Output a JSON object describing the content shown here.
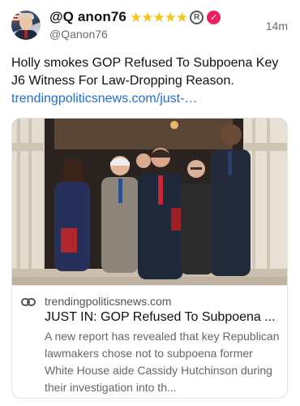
{
  "post": {
    "author": {
      "display_name": "@Q anon76",
      "stars": "★★★★★",
      "registered_mark": "R",
      "verified_mark": "✓",
      "handle": "@Qanon76"
    },
    "timestamp": "14m",
    "text": "Holly smokes GOP Refused To Subpoena Key J6 Witness For Law-Dropping Reason.",
    "link": "trendingpoliticsnews.com/just-…"
  },
  "card": {
    "domain": "trendingpoliticsnews.com",
    "title": "JUST IN: GOP Refused To Subpoena ...",
    "description": "A new report has revealed that key Republican lawmakers chose not to subpoena former White House aide Cassidy Hutchinson during their investigation into th..."
  },
  "colors": {
    "link": "#1e6fd9",
    "stars": "#f5c518",
    "verified_badge": "#e91e63"
  },
  "icons": [
    "link-icon",
    "star-icon",
    "registered-icon",
    "verified-badge-icon"
  ]
}
